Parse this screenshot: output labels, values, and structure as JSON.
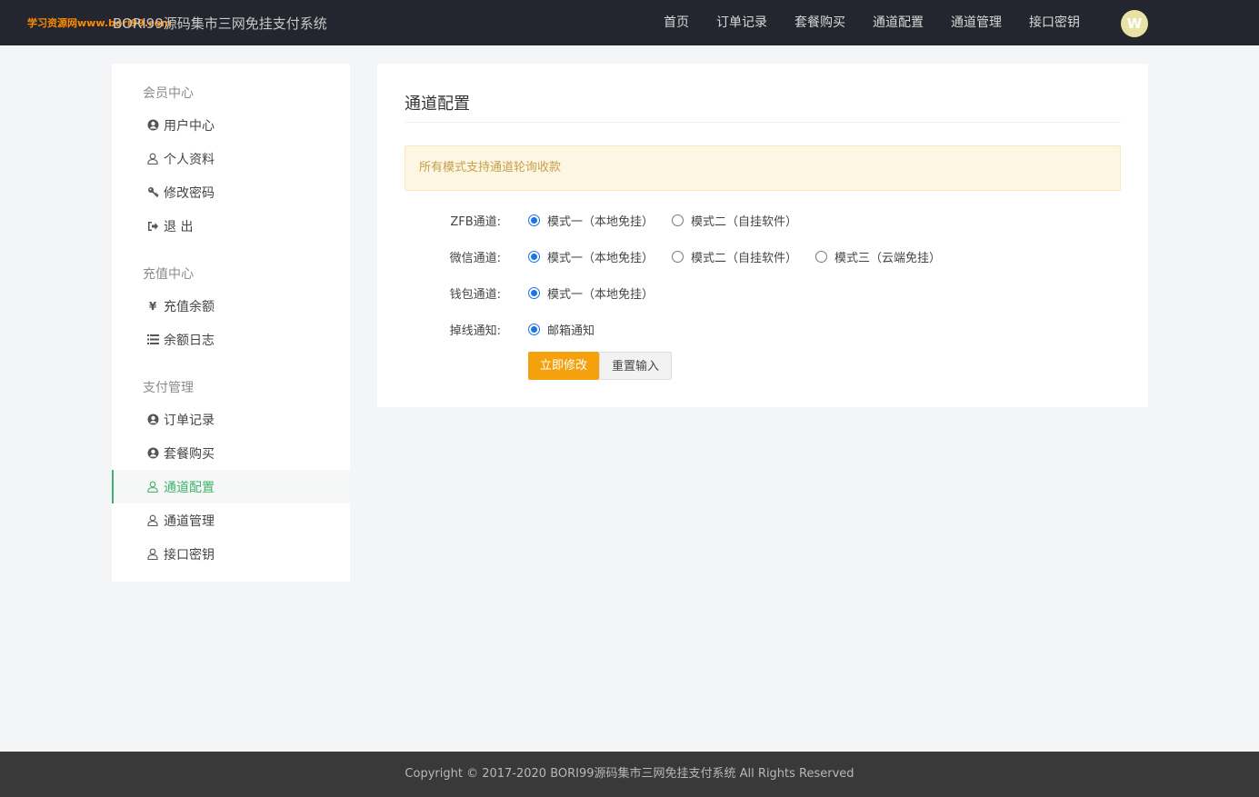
{
  "header": {
    "watermark": "学习资源网www.bori99.com",
    "brand": "BORI99源码集市三网免挂支付系统",
    "nav": [
      "首页",
      "订单记录",
      "套餐购买",
      "通道配置",
      "通道管理",
      "接口密钥"
    ],
    "avatar": "W"
  },
  "sidebar": {
    "groups": [
      {
        "title": "会员中心",
        "items": [
          {
            "label": "用户中心",
            "icon": "user-circle-icon"
          },
          {
            "label": "个人资料",
            "icon": "user-icon"
          },
          {
            "label": "修改密码",
            "icon": "key-icon"
          },
          {
            "label": "退 出",
            "icon": "sign-out-icon"
          }
        ]
      },
      {
        "title": "充值中心",
        "items": [
          {
            "label": "充值余额",
            "icon": "yen-icon"
          },
          {
            "label": "余额日志",
            "icon": "list-icon"
          }
        ]
      },
      {
        "title": "支付管理",
        "items": [
          {
            "label": "订单记录",
            "icon": "user-circle-icon"
          },
          {
            "label": "套餐购买",
            "icon": "user-circle-icon"
          },
          {
            "label": "通道配置",
            "icon": "user-icon",
            "active": true
          },
          {
            "label": "通道管理",
            "icon": "user-icon"
          },
          {
            "label": "接口密钥",
            "icon": "user-icon"
          }
        ]
      }
    ]
  },
  "main": {
    "title": "通道配置",
    "notice": "所有模式支持通道轮询收款",
    "rows": [
      {
        "label": "ZFB通道:",
        "options": [
          {
            "label": "模式一（本地免挂）",
            "checked": true
          },
          {
            "label": "模式二（自挂软件）",
            "checked": false
          }
        ]
      },
      {
        "label": "微信通道:",
        "options": [
          {
            "label": "模式一（本地免挂）",
            "checked": true
          },
          {
            "label": "模式二（自挂软件）",
            "checked": false
          },
          {
            "label": "模式三（云端免挂）",
            "checked": false
          }
        ]
      },
      {
        "label": "钱包通道:",
        "options": [
          {
            "label": "模式一（本地免挂）",
            "checked": true
          }
        ]
      },
      {
        "label": "掉线通知:",
        "options": [
          {
            "label": "邮箱通知",
            "checked": true
          }
        ]
      }
    ],
    "submit_label": "立即修改",
    "reset_label": "重置输入"
  },
  "footer": {
    "copyright": "Copyright © 2017-2020 BORI99源码集市三网免挂支付系统 All Rights Reserved"
  },
  "colors": {
    "topbar": "#23262e",
    "accent_active": "#3fb26b",
    "primary_button": "#f5a10e",
    "radio_checked": "#1a73e8"
  }
}
